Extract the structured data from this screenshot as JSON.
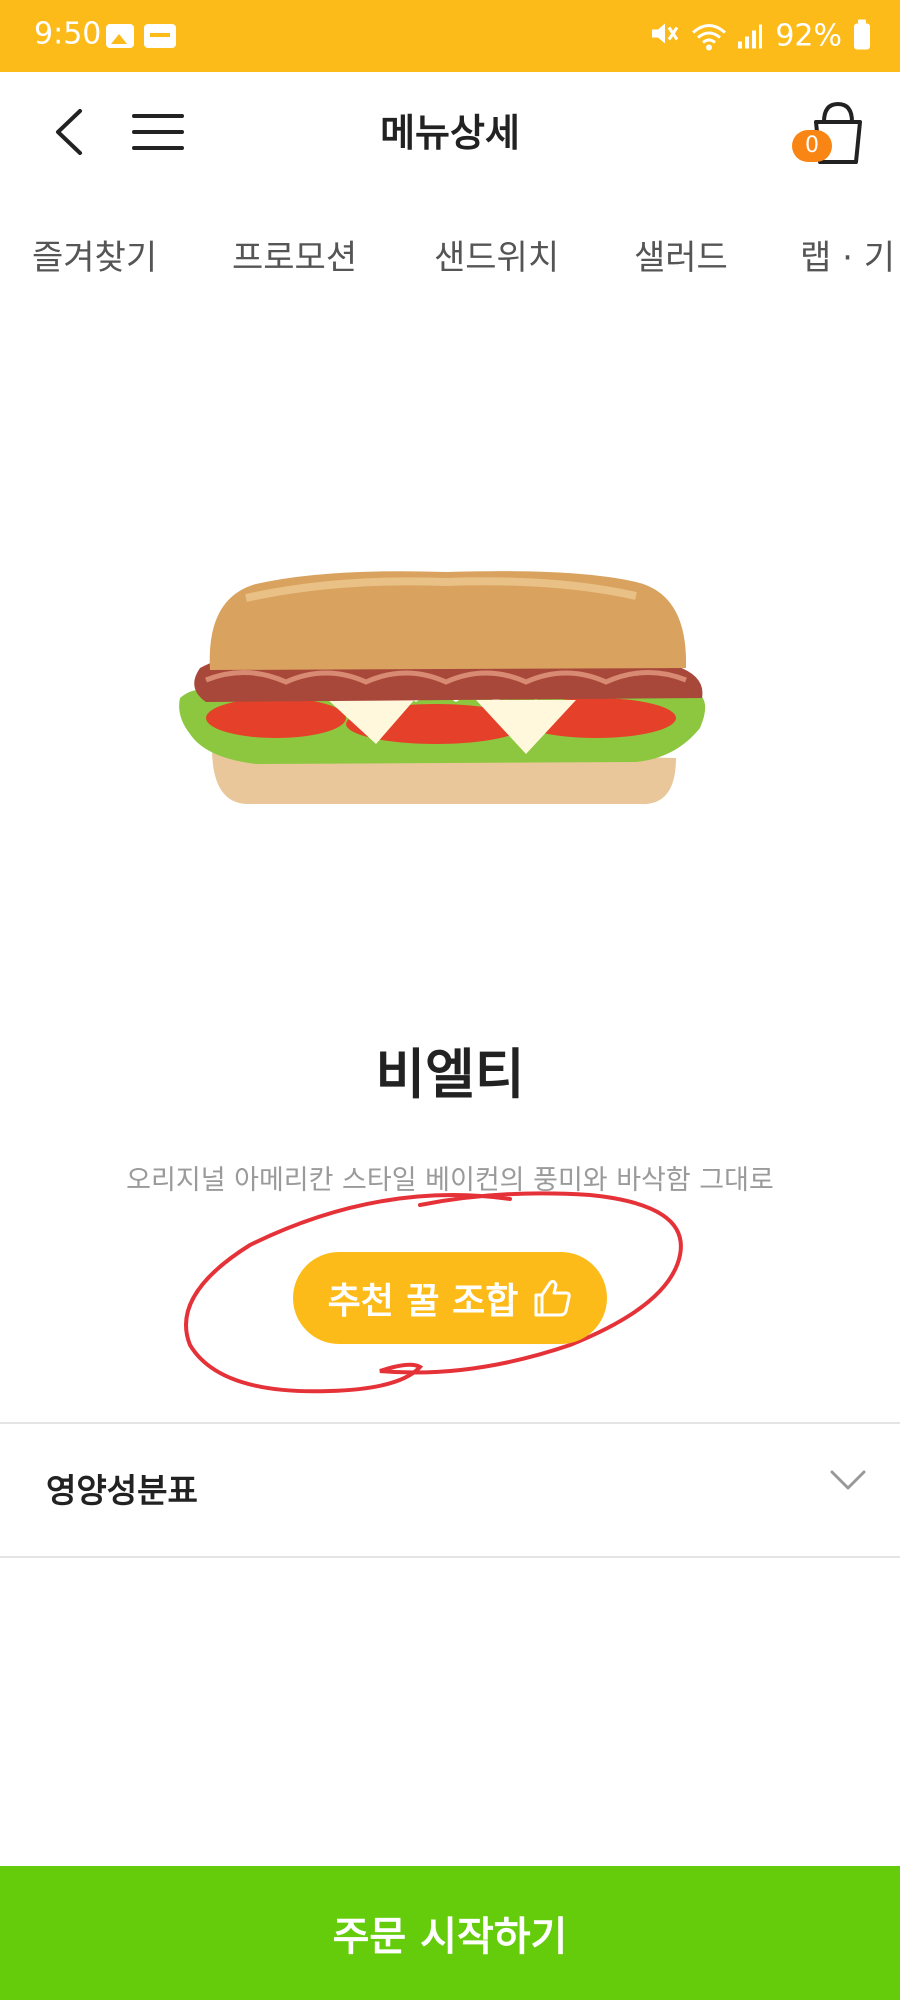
{
  "status_bar": {
    "time": "9:50",
    "battery": "92%",
    "icons": [
      "gallery-icon",
      "message-icon",
      "mute-icon",
      "wifi-icon",
      "signal-icon",
      "battery-icon"
    ]
  },
  "header": {
    "title": "메뉴상세",
    "cart_count": "0"
  },
  "tabs": [
    "즐겨찾기",
    "프로모션",
    "샌드위치",
    "샐러드",
    "랩 · 기"
  ],
  "product": {
    "name": "비엘티",
    "description": "오리지널 아메리칸 스타일 베이컨의 풍미와 바삭함 그대로",
    "recommend_label": "추천 꿀 조합"
  },
  "nutrition": {
    "label": "영양성분표"
  },
  "order_button": "주문 시작하기",
  "colors": {
    "brand_yellow": "#FDBB19",
    "order_green": "#64CC0A",
    "badge_orange": "#F98514",
    "annotation_red": "#E53238"
  }
}
